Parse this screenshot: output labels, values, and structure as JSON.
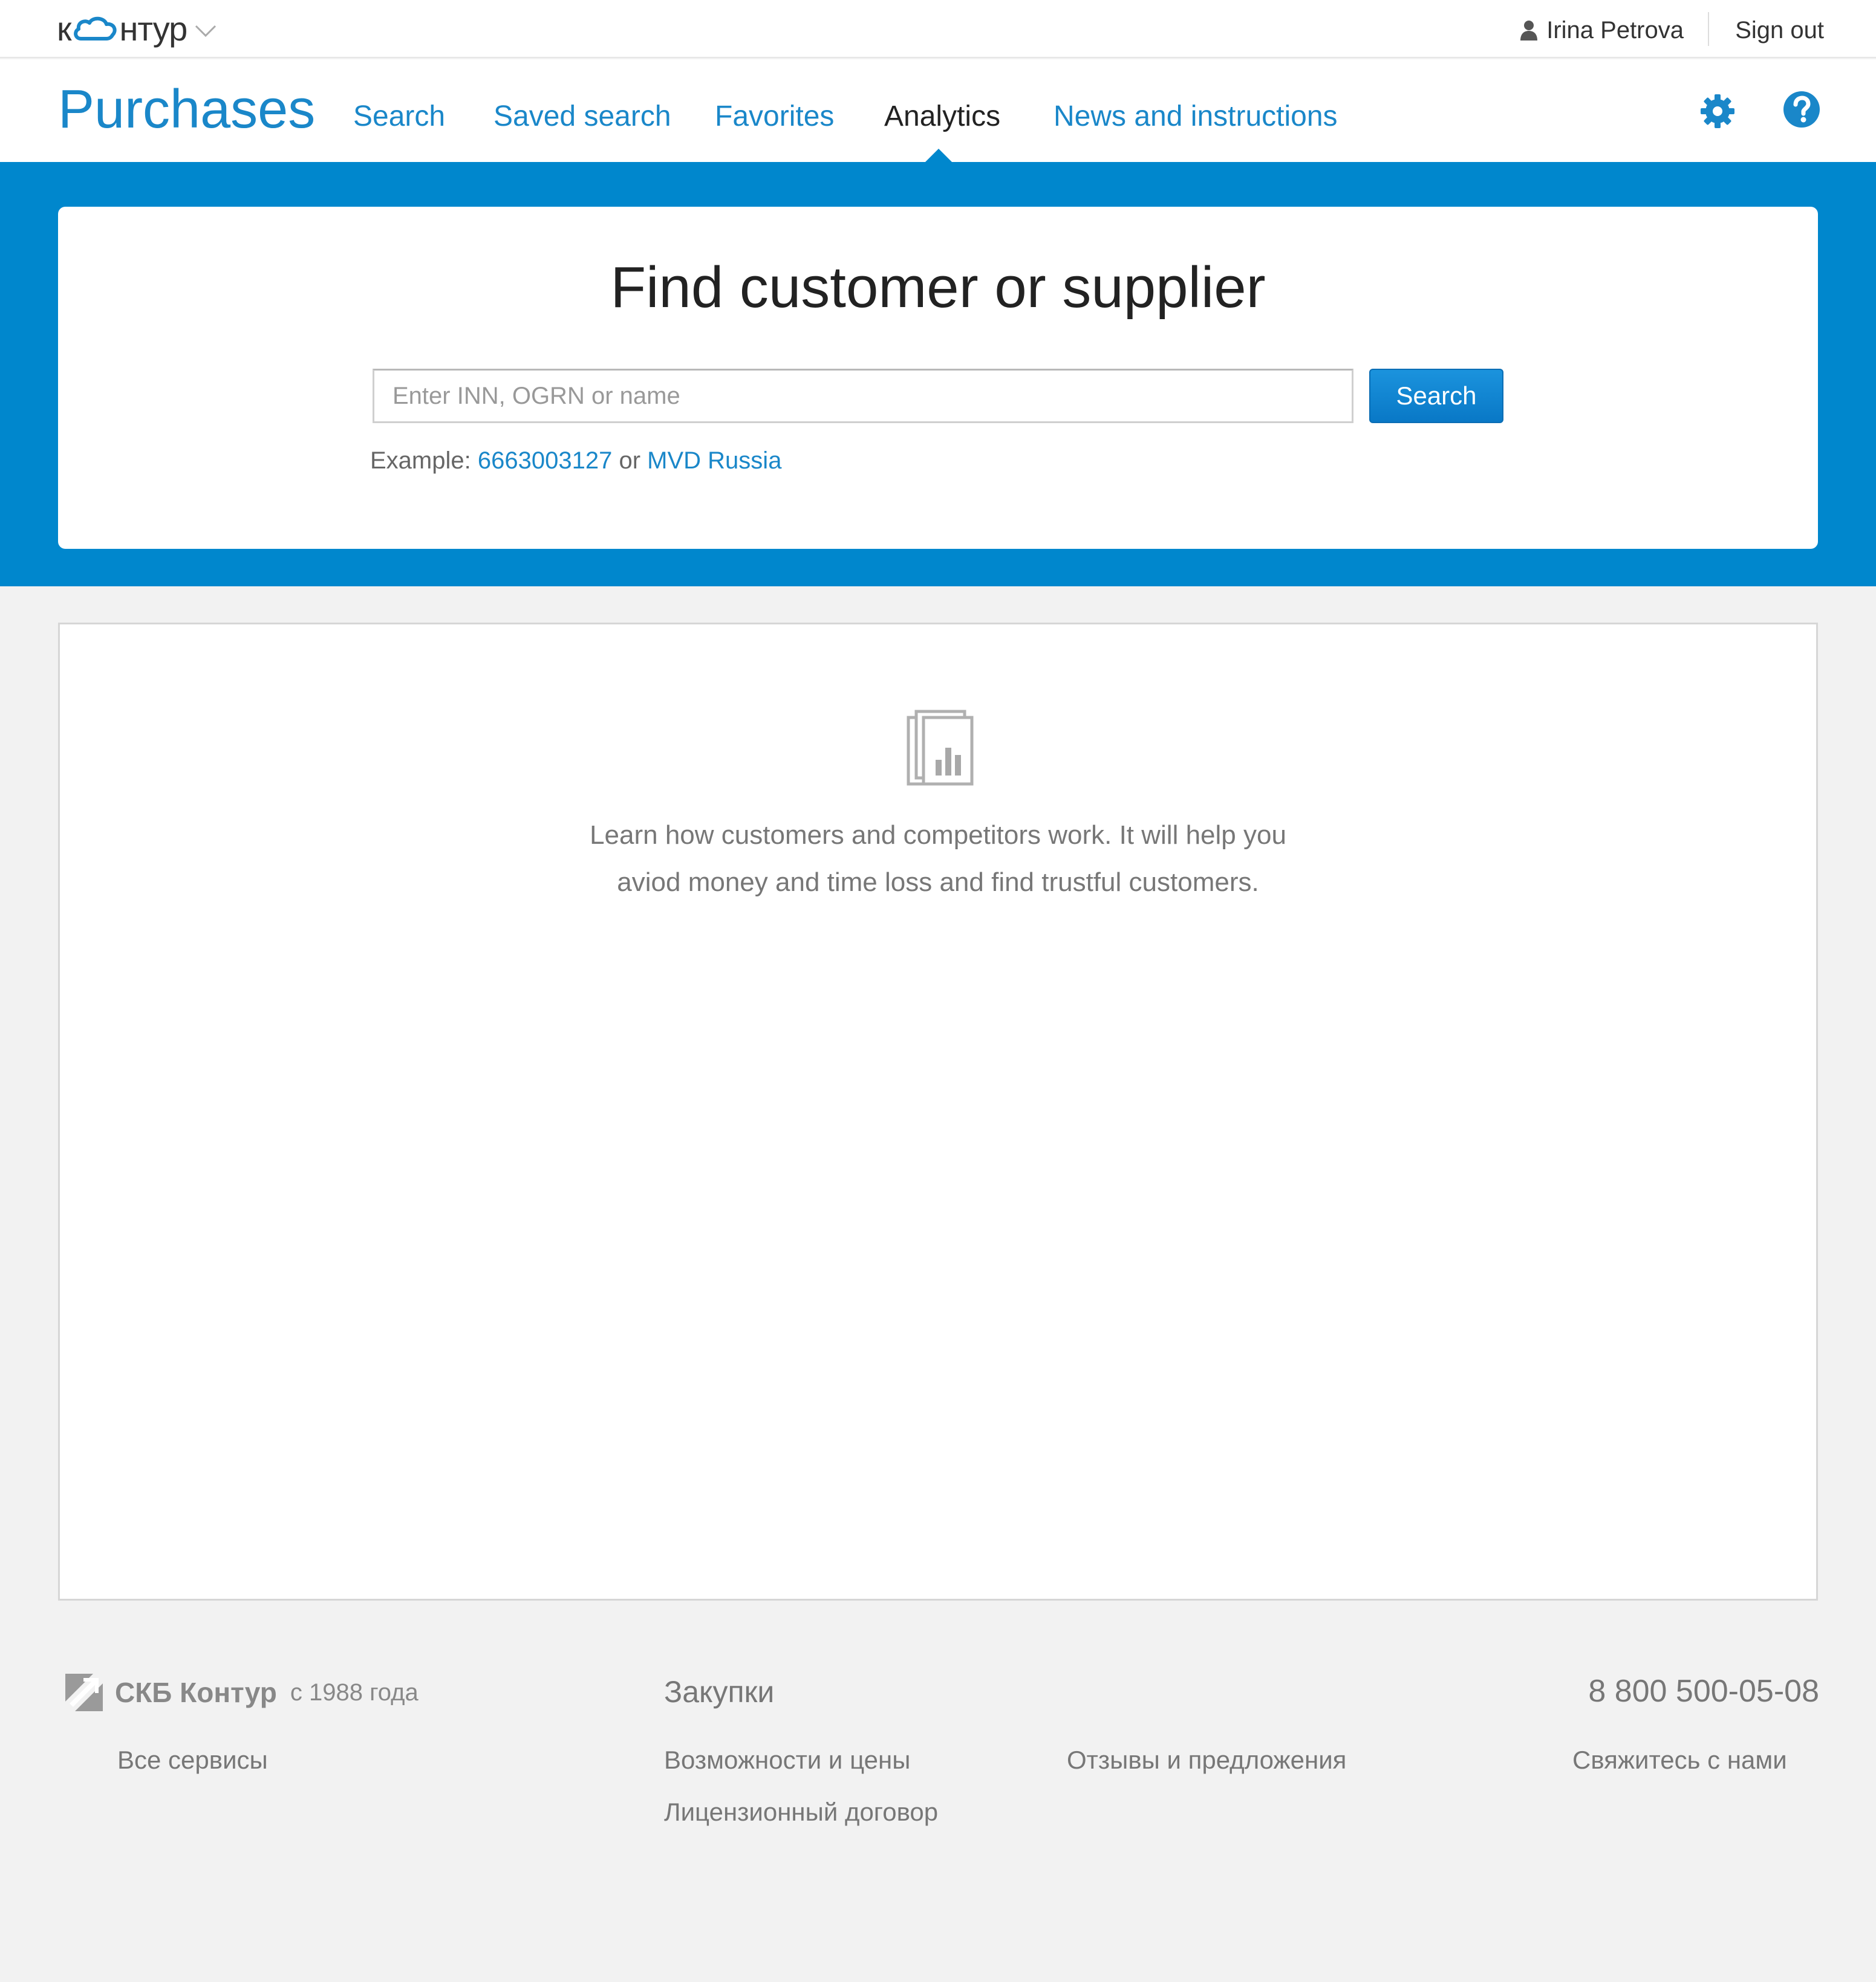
{
  "topbar": {
    "logo_prefix": "к",
    "logo_suffix": "нтур",
    "user_name": "Irina Petrova",
    "sign_out": "Sign out"
  },
  "nav": {
    "brand": "Purchases",
    "tabs": [
      {
        "label": "Search",
        "active": false
      },
      {
        "label": "Saved search",
        "active": false
      },
      {
        "label": "Favorites",
        "active": false
      },
      {
        "label": "Analytics",
        "active": true
      },
      {
        "label": "News and instructions",
        "active": false
      }
    ]
  },
  "search_card": {
    "title": "Find customer or supplier",
    "placeholder": "Enter INN, OGRN or name",
    "value": "",
    "button": "Search",
    "example_label": "Example:",
    "example_inn": "6663003127",
    "example_or": "or",
    "example_name": "MVD Russia"
  },
  "panel": {
    "line1": "Learn how customers and competitors work. It will help you",
    "line2": "aviod money and time loss and find trustful customers."
  },
  "footer": {
    "brand": "СКБ Контур",
    "since": "с 1988 года",
    "heading": "Закупки",
    "phone": "8 800 500-05-08",
    "all_services": "Все сервисы",
    "features": "Возможности и цены",
    "reviews": "Отзывы и предложения",
    "contact": "Свяжитесь с нами",
    "license": "Лицензионный договор"
  },
  "colors": {
    "accent": "#0087cd",
    "link": "#1a87c9",
    "background": "#f2f2f2"
  },
  "icons": [
    "cloud-logo-icon",
    "chevron-down-icon",
    "user-icon",
    "gear-icon",
    "help-icon",
    "analytics-report-icon",
    "skb-kontur-logo-icon"
  ]
}
